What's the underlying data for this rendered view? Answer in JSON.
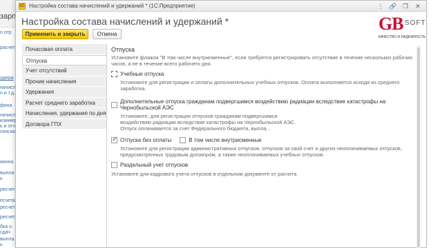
{
  "background": {
    "top_label": "зарпл",
    "links": [
      "о отр",
      "расчет",
      "удерж",
      "начисл",
      "н и т.д.",
      "фина",
      "начисл",
      "коммерч",
      "ь и отч",
      "сенсио",
      "ионно",
      "выпла",
      "ь",
      "ресчет",
      "есчета",
      "ресчета",
      "ресчет",
      "бка о",
      "сдач",
      "выпла",
      "ь"
    ]
  },
  "window": {
    "title": "Настройка состава начислений и удержаний * (1С:Предприятие)",
    "app_icon": "1С"
  },
  "dialog": {
    "heading": "Настройка состава начислений и удержаний *",
    "apply_close_label": "Применить и закрыть",
    "cancel_label": "Отмена"
  },
  "nav": {
    "items": [
      {
        "label": "Почасовая оплата"
      },
      {
        "label": "Отпуска"
      },
      {
        "label": "Учет отсутствий"
      },
      {
        "label": "Прочие начисления"
      },
      {
        "label": "Удержания"
      },
      {
        "label": "Расчет среднего заработка"
      },
      {
        "label": "Начисления, удержания по дням"
      },
      {
        "label": "Договора ГПХ"
      }
    ],
    "active_index": 1
  },
  "content": {
    "section_title": "Отпуска",
    "section_desc": "Установите флажок \"В том числе внутрисменные\", если требуется регистрировать отсутствие в течение нескольких рабочих часов, а не в течение всего рабочего дня.",
    "study_leave": {
      "label": "Учебные отпуска",
      "checked": false,
      "desc": "Установите для регистрации и оплаты дополнительных учебных отпусков. Оплата выполняется исходя из среднего заработка."
    },
    "chernobyl_leave": {
      "label": "Дополнительные отпуска гражданам подвергшимся воздействию радиации вследствие катастрофы на Чернобыльской АЭС",
      "checked": false,
      "desc": "Установите, для регистрации отпусков гражданам подвергшимся воздействию радиации вследствие катастрофы на Чернобыльской АЭС. Отпуск оплачивается за счет Федерального бюджета, выпла..."
    },
    "unpaid_leave": {
      "label": "Отпуска без оплаты",
      "checked": true,
      "intrashift_label": "В том числе внутрисменные",
      "intrashift_checked": false,
      "desc": "Установите для регистрации административных отпусков, отпусков за свой счет и других неоплачиваемых отпусков, предусмотренных трудовым договором, а также неоплачиваемых учебных отпусков."
    },
    "separate_accounting": {
      "label": "Раздельный учет отпусков",
      "checked": false,
      "desc": "Установите для кадрового учета отпусков в отдельном документе от расчета"
    }
  },
  "logo": {
    "brand": "GB",
    "soft": "SOFT",
    "tagline": "КАЧЕСТВО И НАДЕЖНОСТЬ"
  },
  "colors": {
    "primary_button": "#f3c600",
    "logo_red": "#c8102e",
    "checkbox_check": "#1e7a1e"
  }
}
